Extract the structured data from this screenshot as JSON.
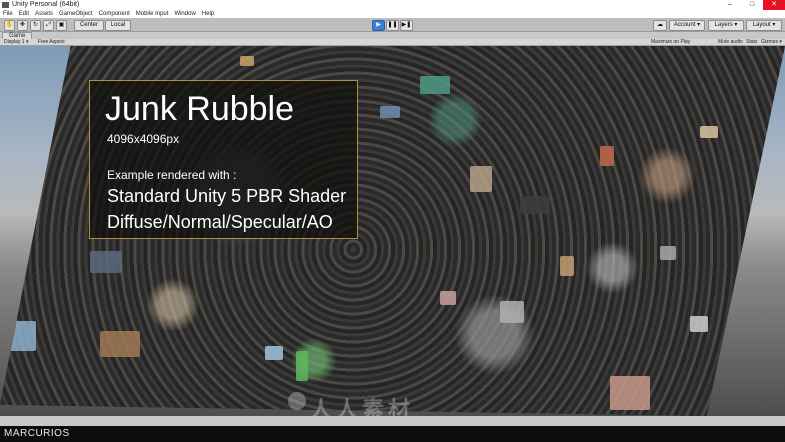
{
  "window": {
    "title": "Unity Personal (64bit)",
    "controls": [
      "–",
      "□",
      "✕"
    ]
  },
  "menu": [
    "File",
    "Edit",
    "Assets",
    "GameObject",
    "Component",
    "Mobile Input",
    "Window",
    "Help"
  ],
  "toolbar": {
    "pivot": "Center",
    "space": "Local",
    "play": "▶",
    "pause": "❚❚",
    "step": "▶❚",
    "cloud_icon": "cloud-icon",
    "account": "Account ▾",
    "layers": "Layers ▾",
    "layout": "Layout ▾"
  },
  "game_view": {
    "tab": "Game",
    "display": "Display 1 ▾",
    "aspect": "Free Aspect",
    "maximize": "Maximize on Play",
    "mute": "Mute audio",
    "stats": "Stats",
    "gizmos": "Gizmos ▾"
  },
  "overlay": {
    "title": "Junk Rubble",
    "size": "4096x4096px",
    "example": "Example rendered with :",
    "shader": "Standard Unity 5 PBR Shader",
    "maps": "Diffuse/Normal/Specular/AO",
    "border_color": "#a9933f"
  },
  "brand": "MARCURIOS",
  "watermark": "人人素材"
}
